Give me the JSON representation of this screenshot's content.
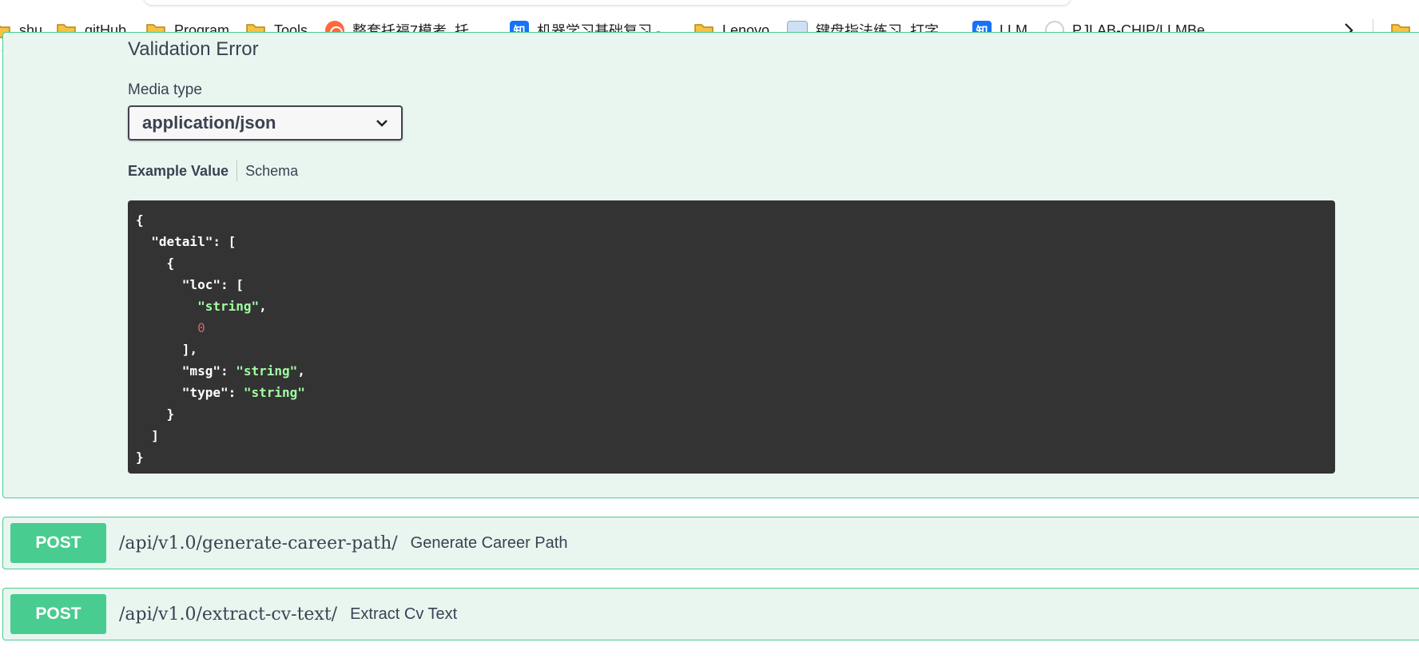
{
  "bookmarks": [
    {
      "icon": "folder-icon",
      "label": "shu"
    },
    {
      "icon": "folder-icon",
      "label": "gitHub"
    },
    {
      "icon": "folder-icon",
      "label": "Program"
    },
    {
      "icon": "folder-icon",
      "label": "Tools"
    },
    {
      "icon": "headset-icon",
      "label": "整套托福7模考_托..."
    },
    {
      "icon": "zhihu-icon",
      "label": "机器学习基础复习 -..."
    },
    {
      "icon": "folder-icon",
      "label": "Lenovo"
    },
    {
      "icon": "keyboard-icon",
      "label": "键盘指法练习_打字..."
    },
    {
      "icon": "zhihu-icon",
      "label": "LLM"
    },
    {
      "icon": "github-icon",
      "label": "PJLAB-CHIP/LLMBe..."
    }
  ],
  "zhihu_glyph": "知",
  "response": {
    "title": "Validation Error",
    "media_type_label": "Media type",
    "media_type_value": "application/json",
    "tabs": [
      "Example Value",
      "Schema"
    ]
  },
  "example_json": {
    "key_detail": "\"detail\"",
    "key_loc": "\"loc\"",
    "loc_string": "\"string\"",
    "loc_number": "0",
    "key_msg": "\"msg\"",
    "msg_value": "\"string\"",
    "key_type": "\"type\"",
    "type_value": "\"string\""
  },
  "operations": [
    {
      "method": "POST",
      "path": "/api/v1.0/generate-career-path/",
      "summary": "Generate Career Path"
    },
    {
      "method": "POST",
      "path": "/api/v1.0/extract-cv-text/",
      "summary": "Extract Cv Text"
    }
  ],
  "colors": {
    "post_green": "#49cc90",
    "post_bg": "#e9f6f0",
    "code_bg": "#333333",
    "code_string": "#a2fca2",
    "code_number": "#d36363",
    "folder_yellow": "#f5c242"
  }
}
